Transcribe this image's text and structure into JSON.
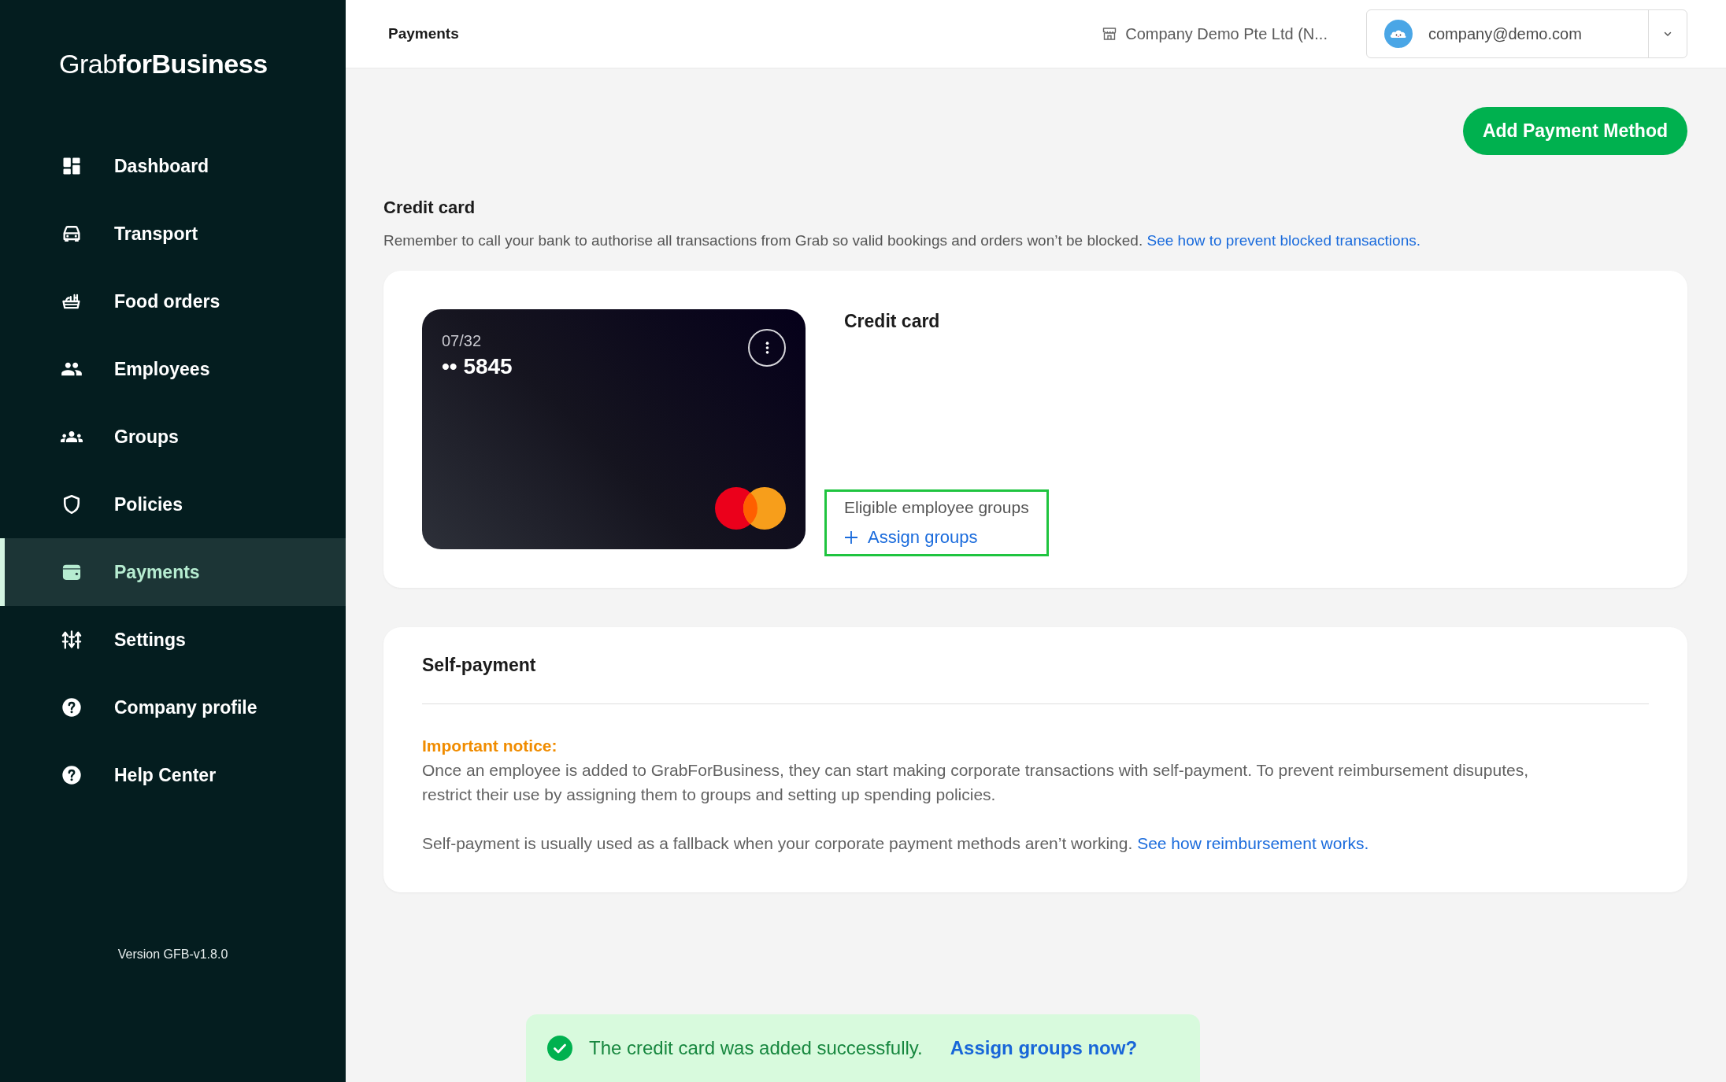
{
  "sidebar": {
    "logo": "Grab**forBusiness**",
    "items": [
      {
        "label": "Dashboard",
        "selected": false
      },
      {
        "label": "Transport",
        "selected": false
      },
      {
        "label": "Food orders",
        "selected": false
      },
      {
        "label": "Employees",
        "selected": false
      },
      {
        "label": "Groups",
        "selected": false
      },
      {
        "label": "Policies",
        "selected": false
      },
      {
        "label": "Payments",
        "selected": true
      },
      {
        "label": "Settings",
        "selected": false
      },
      {
        "label": "Company profile",
        "selected": false
      },
      {
        "label": "Help Center",
        "selected": false
      }
    ],
    "version": "Version GFB-v1.8.0"
  },
  "header": {
    "title": "Payments",
    "company": "Company Demo Pte Ltd (N...",
    "account_email": "company@demo.com"
  },
  "add_payment_button": "Add Payment Method",
  "credit_card": {
    "heading": "Credit card",
    "notice": "Remember to call your bank to authorise all transactions from Grab so valid bookings and orders won’t be blocked.",
    "notice_link": "See how to prevent blocked transactions.",
    "card": {
      "expiry": "07/32",
      "number": "•• 5845"
    },
    "title": "Credit card",
    "eligible_groups": {
      "label": "Eligible employee groups",
      "action": "Assign groups",
      "highlighted": true
    }
  },
  "self_payment": {
    "title": "Self-payment",
    "notice_label": "Important notice:",
    "notice": "Once an employee is added to GrabForBusiness, they can start making corporate transactions with self-payment. To prevent reimbursement disuputes, restrict their use by assigning them to groups and setting up spending policies.",
    "fallback": "Self-payment is usually used as a fallback when your corporate payment methods aren’t working.",
    "fallback_link": "See how reimbursement works."
  },
  "toast": {
    "message": "The credit card was added successfully.",
    "action": "Assign groups now?"
  }
}
